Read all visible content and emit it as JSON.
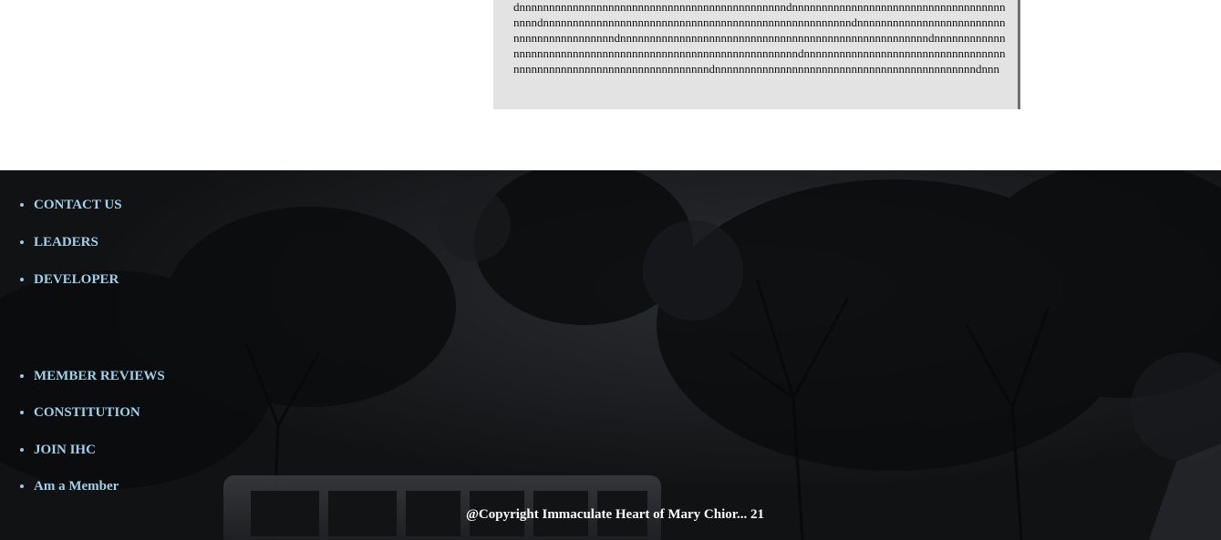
{
  "article": {
    "text": "dnnnnnnnnnnnnnnnnnnnnnnnnnnnnnnnnnnnnnnnnnnnnndnnnnnnnnnnnnnnnnnnnnnnnnnnnnnnnnnnnnnnnndnnnnnnnnnnnnnnnnnnnnnnnnnnnnnnnnnnnnnnnnnnnnnnnnnnnndnnnnnnnnnnnnnnnnnnnnnnnnnnnnnnnnnnnnnnnnnndnnnnnnnnnnnnnnnnnnnnnnnnnnnnnnnnnnnnnnnnnnnnnnnnnnnndnnnnnnnnnnnnnnnnnnnnnnnnnnnnnnnnnnnnnnnnnnnnnnnnnnnnnnnnnnnndnnnnnnnnnnnnnnnnnnnnnnnnnnnnnnnnnnnnnnnnnnnnnnnnnnnnnnnnnnnnnnnnnnndnnnnnnnnnnnnnnnnnnnnnnnnnnnnnnnnnnnnnnnnnnnndnnn"
  },
  "footer": {
    "links": [
      {
        "label": "CONTACT US"
      },
      {
        "label": "LEADERS"
      },
      {
        "label": "DEVELOPER"
      },
      {
        "label": "MEMBER REVIEWS"
      },
      {
        "label": "CONSTITUTION"
      },
      {
        "label": "JOIN IHC"
      },
      {
        "label": "Am a Member"
      }
    ],
    "copyright": "@Copyright Immaculate Heart of Mary Chior... 21"
  }
}
